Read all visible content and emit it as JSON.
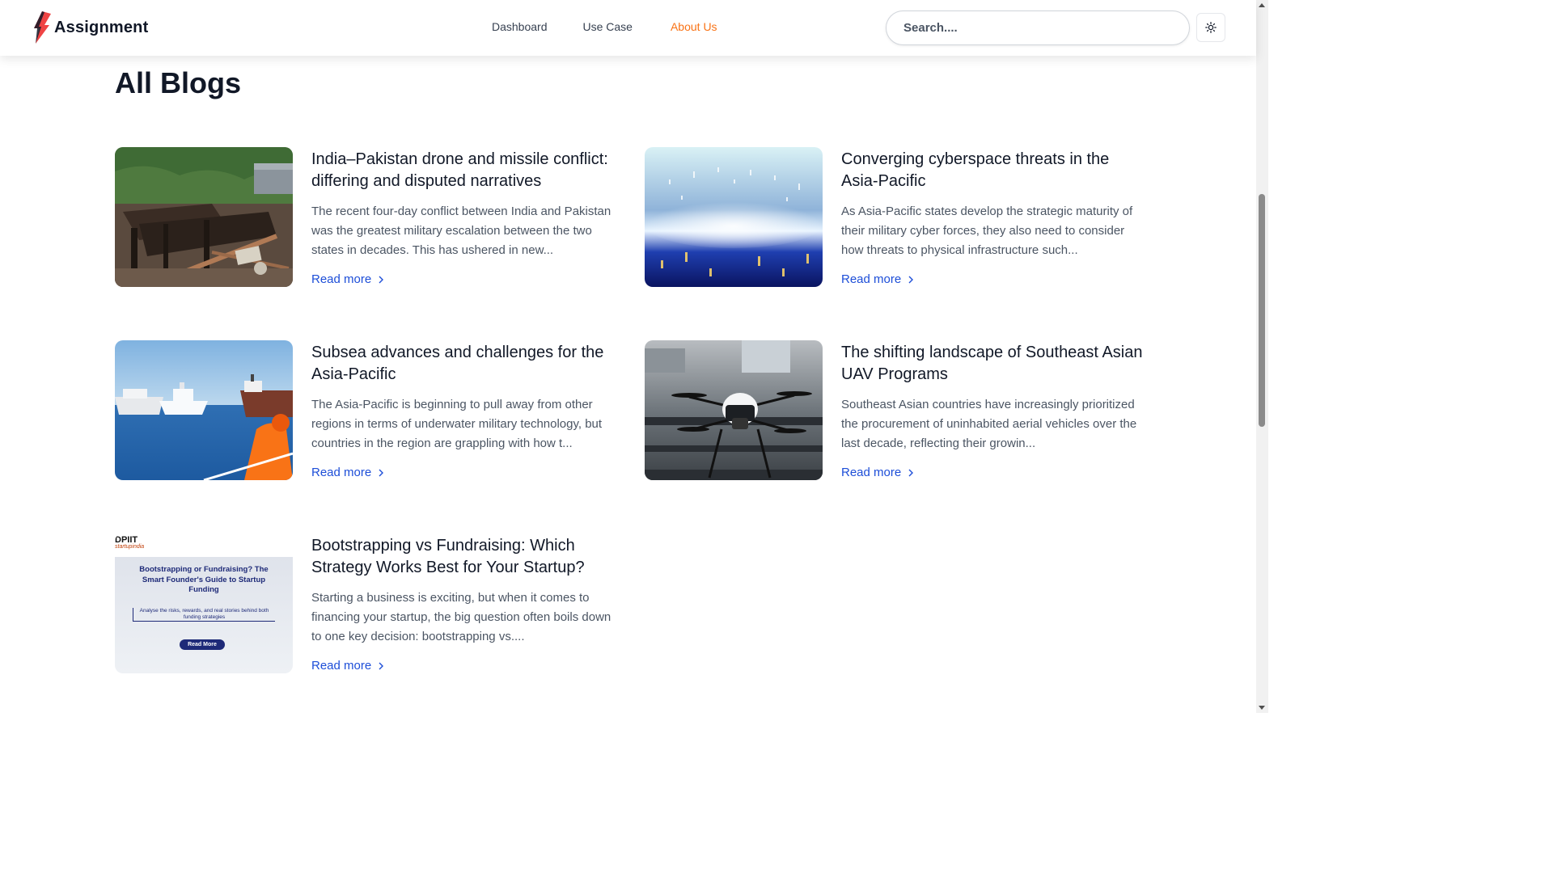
{
  "brand": {
    "name": "Assignment",
    "logo_icon": "lightning-bolt-icon",
    "logo_colors": [
      "#ef4444",
      "#111827"
    ]
  },
  "nav": {
    "items": [
      {
        "label": "Dashboard",
        "active": false
      },
      {
        "label": "Use Case",
        "active": false
      },
      {
        "label": "About Us",
        "active": true
      }
    ],
    "active_color": "#f97316"
  },
  "search": {
    "placeholder": "Search....",
    "value": ""
  },
  "theme_toggle": {
    "icon": "sun-icon"
  },
  "page": {
    "title": "All Blogs"
  },
  "posts": [
    {
      "title": "India–Pakistan drone and missile conflict: differing and disputed narratives",
      "excerpt": "The recent four-day conflict between India and Pakistan was the greatest military escalation between the two states in decades. This has ushered in new...",
      "read_more": "Read more",
      "image": "destroyed-building-photo"
    },
    {
      "title": "Converging cyberspace threats in the Asia-Pacific",
      "excerpt": "As Asia-Pacific states develop the strategic maturity of their military cyber forces, they also need to consider how threats to physical infrastructure such...",
      "read_more": "Read more",
      "image": "digital-tunnel-photo"
    },
    {
      "title": "Subsea advances and challenges for the Asia-Pacific",
      "excerpt": "The Asia-Pacific is beginning to pull away from other regions in terms of underwater military technology, but countries in the region are grappling with how t...",
      "read_more": "Read more",
      "image": "ships-at-sea-photo"
    },
    {
      "title": "The shifting landscape of Southeast Asian UAV Programs",
      "excerpt": "Southeast Asian countries have increasingly prioritized the procurement of uninhabited aerial vehicles over the last decade, reflecting their growin...",
      "read_more": "Read more",
      "image": "drone-photo"
    },
    {
      "title": "Bootstrapping vs Fundraising: Which Strategy Works Best for Your Startup?",
      "excerpt": "Starting a business is exciting, but when it comes to financing your startup, the big question often boils down to one key decision: bootstrapping vs....",
      "read_more": "Read more",
      "image": "startup-funding-banner",
      "image_text": {
        "badge": "DPIIT",
        "badge_sub": "startupindia",
        "heading": "Bootstrapping or Fundraising? The Smart Founder's Guide to Startup Funding",
        "subheading": "Analyse the risks, rewards, and real stories behind both funding strategies",
        "button": "Read More"
      }
    }
  ],
  "colors": {
    "link": "#1d4ed8",
    "heading": "#111827",
    "body_text": "#4b5563"
  }
}
